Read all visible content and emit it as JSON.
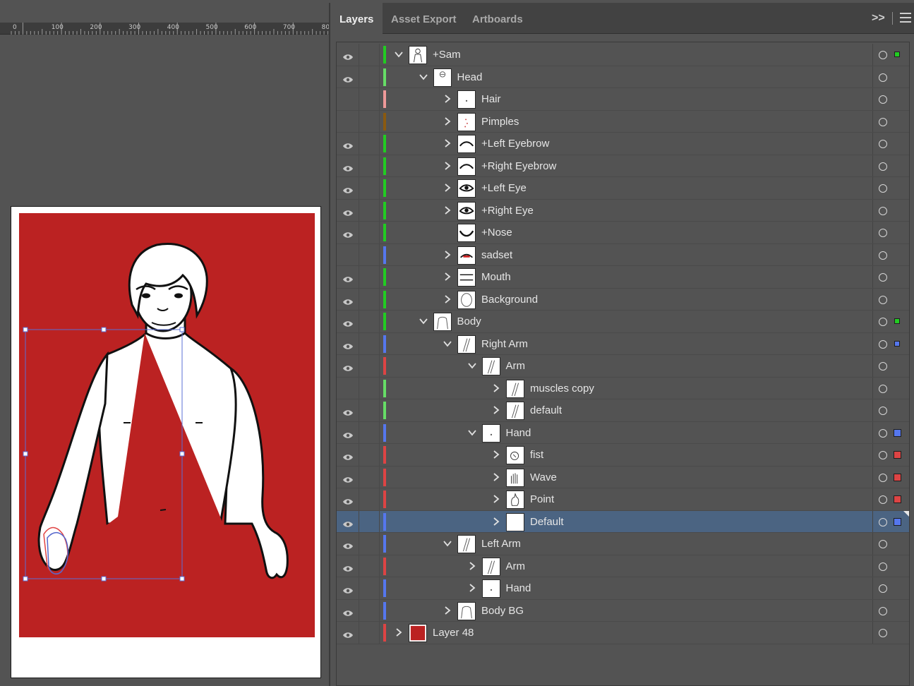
{
  "tabs": [
    {
      "label": "Layers",
      "active": true
    },
    {
      "label": "Asset Export",
      "active": false
    },
    {
      "label": "Artboards",
      "active": false
    }
  ],
  "panel_controls": {
    "collapse_glyph": ">>"
  },
  "ruler": {
    "labels": [
      "0",
      "100",
      "200",
      "300",
      "400",
      "500",
      "600",
      "700",
      "80"
    ]
  },
  "colors": {
    "artwork_background": "#bb2222",
    "selection_blue": "#5b6fd6",
    "layer_green": "#22cc22",
    "layer_light_green": "#66dd66",
    "layer_pink": "#ee9999",
    "layer_brown": "#8a5a10",
    "layer_blue": "#5577ee",
    "layer_red": "#dd4444",
    "selected_row": "#4b6482"
  },
  "layers": [
    {
      "name": "+Sam",
      "depth": 0,
      "visible": true,
      "expanded": true,
      "has_children": true,
      "color": "#22cc22",
      "thumb": "figure",
      "selection": "small-green"
    },
    {
      "name": "Head",
      "depth": 1,
      "visible": true,
      "expanded": true,
      "has_children": true,
      "color": "#66dd66",
      "thumb": "head"
    },
    {
      "name": "Hair",
      "depth": 2,
      "visible": false,
      "expanded": false,
      "has_children": true,
      "color": "#ee9999",
      "thumb": "dot"
    },
    {
      "name": "Pimples",
      "depth": 2,
      "visible": false,
      "expanded": false,
      "has_children": true,
      "color": "#8a5a10",
      "thumb": "dots"
    },
    {
      "name": "+Left Eyebrow",
      "depth": 2,
      "visible": true,
      "expanded": false,
      "has_children": true,
      "color": "#22cc22",
      "thumb": "brow"
    },
    {
      "name": "+Right Eyebrow",
      "depth": 2,
      "visible": true,
      "expanded": false,
      "has_children": true,
      "color": "#22cc22",
      "thumb": "brow"
    },
    {
      "name": "+Left Eye",
      "depth": 2,
      "visible": true,
      "expanded": false,
      "has_children": true,
      "color": "#22cc22",
      "thumb": "eye"
    },
    {
      "name": "+Right Eye",
      "depth": 2,
      "visible": true,
      "expanded": false,
      "has_children": true,
      "color": "#22cc22",
      "thumb": "eye"
    },
    {
      "name": "+Nose",
      "depth": 2,
      "visible": true,
      "expanded": false,
      "has_children": false,
      "color": "#22cc22",
      "thumb": "nose"
    },
    {
      "name": "sadset",
      "depth": 2,
      "visible": false,
      "expanded": false,
      "has_children": true,
      "color": "#5577ee",
      "thumb": "sad"
    },
    {
      "name": "Mouth",
      "depth": 2,
      "visible": true,
      "expanded": false,
      "has_children": true,
      "color": "#22cc22",
      "thumb": "mouth"
    },
    {
      "name": "Background",
      "depth": 2,
      "visible": true,
      "expanded": false,
      "has_children": true,
      "color": "#22cc22",
      "thumb": "headbg"
    },
    {
      "name": "Body",
      "depth": 1,
      "visible": true,
      "expanded": true,
      "has_children": true,
      "color": "#22cc22",
      "thumb": "body",
      "selection": "small-green"
    },
    {
      "name": "Right Arm",
      "depth": 2,
      "visible": true,
      "expanded": true,
      "has_children": true,
      "color": "#5577ee",
      "thumb": "arm",
      "selection": "small-blue"
    },
    {
      "name": "Arm",
      "depth": 3,
      "visible": true,
      "expanded": true,
      "has_children": true,
      "color": "#dd4444",
      "thumb": "arm"
    },
    {
      "name": "muscles copy",
      "depth": 4,
      "visible": false,
      "expanded": false,
      "has_children": true,
      "color": "#66dd66",
      "thumb": "arm"
    },
    {
      "name": "default",
      "depth": 4,
      "visible": true,
      "expanded": false,
      "has_children": true,
      "color": "#66dd66",
      "thumb": "arm"
    },
    {
      "name": "Hand",
      "depth": 3,
      "visible": true,
      "expanded": true,
      "has_children": true,
      "color": "#5577ee",
      "thumb": "dot",
      "selection": "blue"
    },
    {
      "name": "fist",
      "depth": 4,
      "visible": true,
      "expanded": false,
      "has_children": true,
      "color": "#dd4444",
      "thumb": "fist",
      "selection": "red"
    },
    {
      "name": "Wave",
      "depth": 4,
      "visible": true,
      "expanded": false,
      "has_children": true,
      "color": "#dd4444",
      "thumb": "wave",
      "selection": "red"
    },
    {
      "name": "Point",
      "depth": 4,
      "visible": true,
      "expanded": false,
      "has_children": true,
      "color": "#dd4444",
      "thumb": "point",
      "selection": "red"
    },
    {
      "name": "Default",
      "depth": 4,
      "visible": true,
      "expanded": false,
      "has_children": true,
      "color": "#5577ee",
      "thumb": "blank",
      "selection": "blue",
      "selected": true
    },
    {
      "name": "Left Arm",
      "depth": 2,
      "visible": true,
      "expanded": true,
      "has_children": true,
      "color": "#5577ee",
      "thumb": "arm"
    },
    {
      "name": "Arm",
      "depth": 3,
      "visible": true,
      "expanded": false,
      "has_children": true,
      "color": "#dd4444",
      "thumb": "arm"
    },
    {
      "name": "Hand",
      "depth": 3,
      "visible": true,
      "expanded": false,
      "has_children": true,
      "color": "#5577ee",
      "thumb": "dot"
    },
    {
      "name": "Body BG",
      "depth": 2,
      "visible": true,
      "expanded": false,
      "has_children": true,
      "color": "#5577ee",
      "thumb": "body"
    },
    {
      "name": "Layer 48",
      "depth": 0,
      "visible": true,
      "expanded": false,
      "has_children": true,
      "color": "#dd4444",
      "thumb": "red"
    }
  ]
}
